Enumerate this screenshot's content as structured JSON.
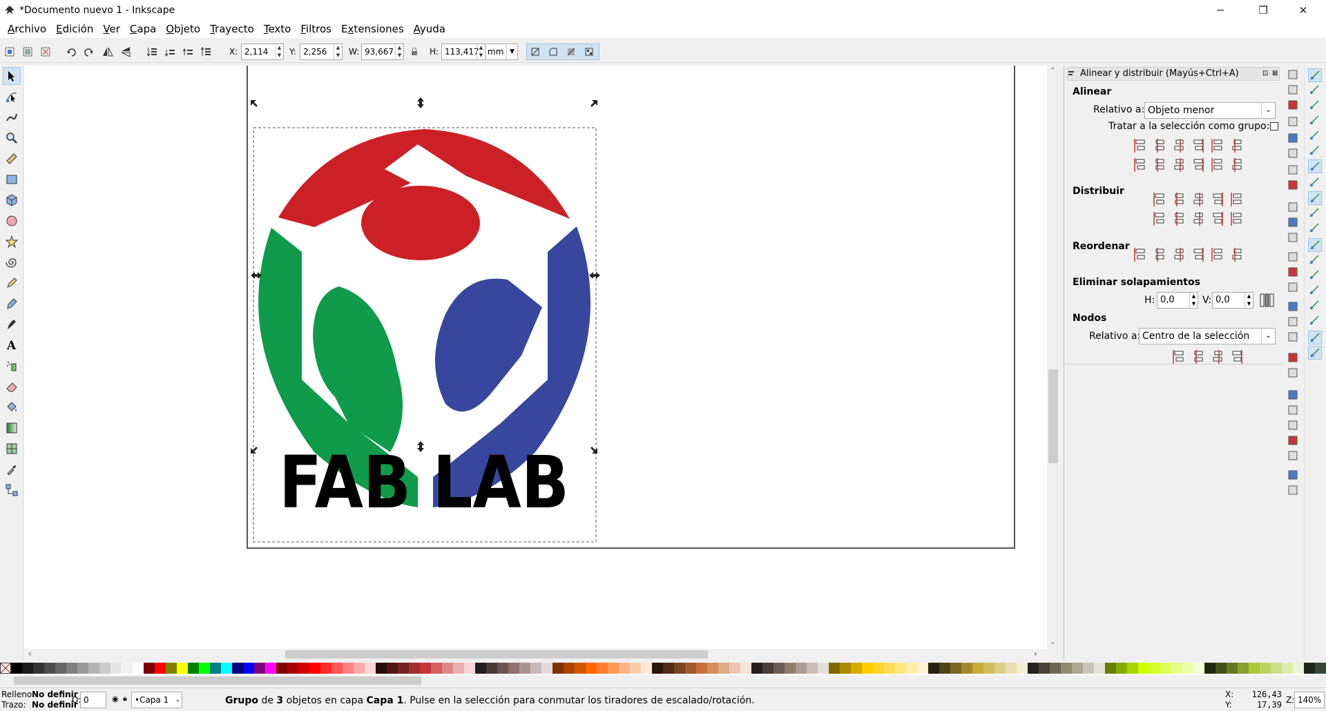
{
  "window": {
    "title": "*Documento nuevo 1 - Inkscape",
    "minimize_icon": "minimize-icon",
    "maximize_icon": "restore-icon",
    "close_icon": "close-icon"
  },
  "menu": [
    "Archivo",
    "Edición",
    "Ver",
    "Capa",
    "Objeto",
    "Trayecto",
    "Texto",
    "Filtros",
    "Extensiones",
    "Ayuda"
  ],
  "menu_mnemonics": [
    "A",
    "E",
    "V",
    "C",
    "O",
    "T",
    "T",
    "F",
    "x",
    "A"
  ],
  "toolctrl": {
    "x_label": "X:",
    "x_value": "2,114",
    "y_label": "Y:",
    "y_value": "2,256",
    "w_label": "W:",
    "w_value": "93,667",
    "h_label": "H:",
    "h_value": "113,417",
    "unit": "mm",
    "lock_icon": "lock-icon"
  },
  "canvas": {
    "logo_text": "FAB LAB",
    "colors": {
      "red": "#cc2027",
      "green": "#0f9b4a",
      "blue": "#36479d",
      "black": "#000000"
    }
  },
  "dock": {
    "title": "Alinear y distribuir (Mayús+Ctrl+A)",
    "align": {
      "heading": "Alinear",
      "relative_label": "Relativo a:",
      "relative_value": "Objeto menor",
      "group_label": "Tratar a la selección como grupo:",
      "group_checked": false
    },
    "distribute": {
      "heading": "Distribuir"
    },
    "reorder": {
      "heading": "Reordenar"
    },
    "remove_overlap": {
      "heading": "Eliminar solapamientos",
      "h_label": "H:",
      "h_value": "0,0",
      "v_label": "V:",
      "v_value": "0,0"
    },
    "nodes": {
      "heading": "Nodos",
      "relative_label": "Relativo a:",
      "relative_value": "Centro de la selección"
    }
  },
  "palette": [
    "#000000",
    "#1a1a1a",
    "#333333",
    "#4d4d4d",
    "#666666",
    "#808080",
    "#999999",
    "#b3b3b3",
    "#cccccc",
    "#e6e6e6",
    "#f2f2f2",
    "#ffffff",
    "#800000",
    "#ff0000",
    "#808000",
    "#ffff00",
    "#008000",
    "#00ff00",
    "#008080",
    "#00ffff",
    "#000080",
    "#0000ff",
    "#800080",
    "#ff00ff",
    "#800000",
    "#aa0000",
    "#d40000",
    "#ff0000",
    "#ff2a2a",
    "#ff5555",
    "#ff8080",
    "#ffaaaa",
    "#ffd5d5",
    "#280b0b",
    "#501616",
    "#782121",
    "#a02c2c",
    "#c83737",
    "#d35f5f",
    "#de8787",
    "#e9afaf",
    "#f4d7d7",
    "#241c1c",
    "#483737",
    "#6c5353",
    "#916f6f",
    "#ac9393",
    "#c8b7b7",
    "#e3dbdb",
    "#803300",
    "#aa4400",
    "#d45500",
    "#ff6600",
    "#ff7f2a",
    "#ff9955",
    "#ffb380",
    "#ffccaa",
    "#ffe6d5",
    "#28170b",
    "#502d16",
    "#784421",
    "#a05a2c",
    "#c87137",
    "#d38d5f",
    "#deaa87",
    "#e9c6af",
    "#f4e3d7",
    "#241f1c",
    "#483e37",
    "#6c5d53",
    "#917c6f",
    "#ac9d93",
    "#c8beb7",
    "#e3dedb",
    "#806600",
    "#aa8800",
    "#d4aa00",
    "#ffcc00",
    "#ffd42a",
    "#ffdd55",
    "#ffe680",
    "#ffeeaa",
    "#fff6d5",
    "#28220b",
    "#504416",
    "#786721",
    "#a0892c",
    "#c8ab37",
    "#d3bc5f",
    "#decd87",
    "#e9ddaf",
    "#f4eed7",
    "#24221c",
    "#484537",
    "#6c6753",
    "#918a6f",
    "#aca793",
    "#c8c4b7",
    "#e3e2db",
    "#668000",
    "#88aa00",
    "#aad400",
    "#ccff00",
    "#d4ff2a",
    "#ddff55",
    "#e5ff80",
    "#eeffaa",
    "#f6ffd5",
    "#22280b",
    "#445016",
    "#677821",
    "#89a02c",
    "#abc837",
    "#bcd35f",
    "#cdde87",
    "#dde9af",
    "#eef4d7",
    "#1c241c",
    "#374837"
  ],
  "status": {
    "fill_label": "Relleno:",
    "fill_value": "No definir",
    "stroke_label": "Trazo:",
    "stroke_value": "No definir",
    "opacity_label": "O:",
    "opacity_value": "0",
    "layer": "•Capa 1",
    "message_prefix": "Grupo",
    "message_p1": " de ",
    "message_count": "3",
    "message_p2": " objetos en capa ",
    "message_layer": "Capa 1",
    "message_p3": ". Pulse en la selección para conmutar los tiradores de escalado/rotación.",
    "x_label": "X:",
    "x_value": "126,43",
    "y_label": "Y:",
    "y_value": "17,39",
    "zoom_label": "Z:",
    "zoom_value": "140%"
  }
}
